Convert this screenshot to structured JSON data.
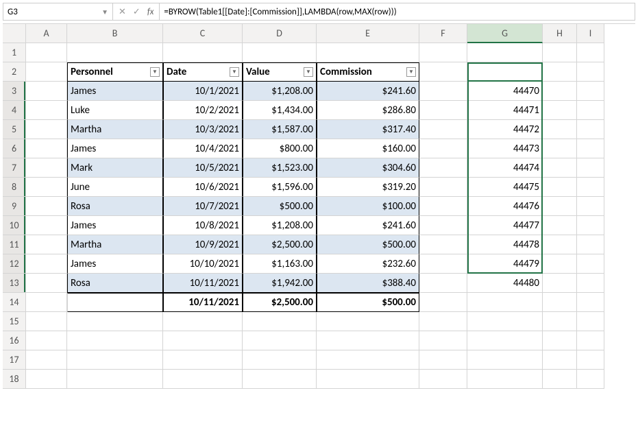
{
  "name_box": "G3",
  "formula": "=BYROW(Table1[[Date]:[Commission]],LAMBDA(row,MAX(row)))",
  "col_headers": [
    "A",
    "B",
    "C",
    "D",
    "E",
    "F",
    "G",
    "H",
    "I"
  ],
  "row_headers": [
    "1",
    "2",
    "3",
    "4",
    "5",
    "6",
    "7",
    "8",
    "9",
    "10",
    "11",
    "12",
    "13",
    "14",
    "15",
    "16",
    "17",
    "18"
  ],
  "table": {
    "headers": {
      "b": "Personnel",
      "c": "Date",
      "d": "Value",
      "e": "Commission"
    },
    "rows": [
      {
        "b": "James",
        "c": "10/1/2021",
        "d": "$1,208.00",
        "e": "$241.60",
        "g": "44470"
      },
      {
        "b": "Luke",
        "c": "10/2/2021",
        "d": "$1,434.00",
        "e": "$286.80",
        "g": "44471"
      },
      {
        "b": "Martha",
        "c": "10/3/2021",
        "d": "$1,587.00",
        "e": "$317.40",
        "g": "44472"
      },
      {
        "b": "James",
        "c": "10/4/2021",
        "d": "$800.00",
        "e": "$160.00",
        "g": "44473"
      },
      {
        "b": "Mark",
        "c": "10/5/2021",
        "d": "$1,523.00",
        "e": "$304.60",
        "g": "44474"
      },
      {
        "b": "June",
        "c": "10/6/2021",
        "d": "$1,596.00",
        "e": "$319.20",
        "g": "44475"
      },
      {
        "b": "Rosa",
        "c": "10/7/2021",
        "d": "$500.00",
        "e": "$100.00",
        "g": "44476"
      },
      {
        "b": "James",
        "c": "10/8/2021",
        "d": "$1,208.00",
        "e": "$241.60",
        "g": "44477"
      },
      {
        "b": "Martha",
        "c": "10/9/2021",
        "d": "$2,500.00",
        "e": "$500.00",
        "g": "44478"
      },
      {
        "b": "James",
        "c": "10/10/2021",
        "d": "$1,163.00",
        "e": "$232.60",
        "g": "44479"
      },
      {
        "b": "Rosa",
        "c": "10/11/2021",
        "d": "$1,942.00",
        "e": "$388.40",
        "g": "44480"
      }
    ],
    "totals": {
      "c": "10/11/2021",
      "d": "$2,500.00",
      "e": "$500.00"
    }
  }
}
